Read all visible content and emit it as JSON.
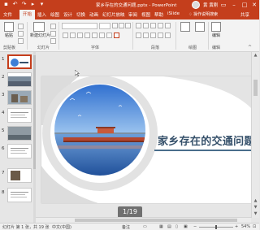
{
  "titlebar": {
    "title": "家乡存在的交通问题.pptx - PowerPoint",
    "user": "黄 黄刚",
    "quick_access": [
      "save-icon",
      "undo-icon",
      "redo-icon",
      "start-from-beginning-icon",
      "customize-icon"
    ]
  },
  "tabs": [
    "文件",
    "开始",
    "插入",
    "绘图",
    "设计",
    "切换",
    "动画",
    "幻灯片放映",
    "审阅",
    "视图",
    "帮助",
    "iSlide"
  ],
  "active_tab": "开始",
  "tell_me": "操作说明搜索",
  "share": "共享",
  "ribbon": {
    "paste": "粘贴",
    "new_slide": "新建幻灯片",
    "editing": "编辑",
    "groups": [
      "剪贴板",
      "幻灯片",
      "字体",
      "段落",
      "绘图",
      "编辑"
    ]
  },
  "thumbnails": [
    {
      "num": "1"
    },
    {
      "num": "2"
    },
    {
      "num": "3"
    },
    {
      "num": "4"
    },
    {
      "num": "5"
    },
    {
      "num": "6"
    },
    {
      "num": "7"
    },
    {
      "num": "8"
    }
  ],
  "slide": {
    "title": "家乡存在的交通问题"
  },
  "pager": "1/19",
  "status": {
    "slide_info": "幻灯片 第 1 张，共 19 张",
    "language": "中文(中国)",
    "notes": "备注",
    "zoom": "54%"
  },
  "colors": {
    "accent": "#c43e1c",
    "title_text": "#35506a",
    "sky": "#3d7fd6",
    "sea": "#2e6bbd",
    "pier": "#b5462e"
  }
}
